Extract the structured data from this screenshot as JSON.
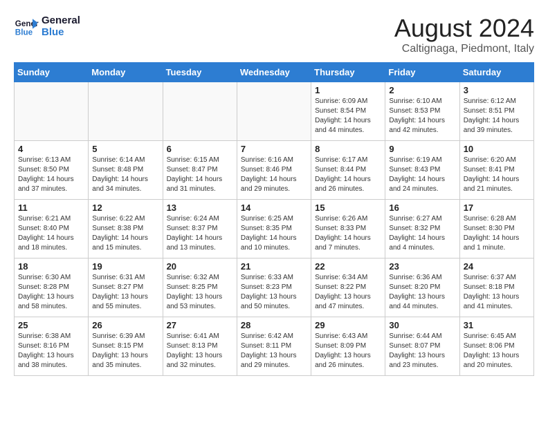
{
  "header": {
    "logo_line1": "General",
    "logo_line2": "Blue",
    "month_year": "August 2024",
    "location": "Caltignaga, Piedmont, Italy"
  },
  "days_of_week": [
    "Sunday",
    "Monday",
    "Tuesday",
    "Wednesday",
    "Thursday",
    "Friday",
    "Saturday"
  ],
  "weeks": [
    [
      {
        "day": "",
        "info": ""
      },
      {
        "day": "",
        "info": ""
      },
      {
        "day": "",
        "info": ""
      },
      {
        "day": "",
        "info": ""
      },
      {
        "day": "1",
        "info": "Sunrise: 6:09 AM\nSunset: 8:54 PM\nDaylight: 14 hours and 44 minutes."
      },
      {
        "day": "2",
        "info": "Sunrise: 6:10 AM\nSunset: 8:53 PM\nDaylight: 14 hours and 42 minutes."
      },
      {
        "day": "3",
        "info": "Sunrise: 6:12 AM\nSunset: 8:51 PM\nDaylight: 14 hours and 39 minutes."
      }
    ],
    [
      {
        "day": "4",
        "info": "Sunrise: 6:13 AM\nSunset: 8:50 PM\nDaylight: 14 hours and 37 minutes."
      },
      {
        "day": "5",
        "info": "Sunrise: 6:14 AM\nSunset: 8:48 PM\nDaylight: 14 hours and 34 minutes."
      },
      {
        "day": "6",
        "info": "Sunrise: 6:15 AM\nSunset: 8:47 PM\nDaylight: 14 hours and 31 minutes."
      },
      {
        "day": "7",
        "info": "Sunrise: 6:16 AM\nSunset: 8:46 PM\nDaylight: 14 hours and 29 minutes."
      },
      {
        "day": "8",
        "info": "Sunrise: 6:17 AM\nSunset: 8:44 PM\nDaylight: 14 hours and 26 minutes."
      },
      {
        "day": "9",
        "info": "Sunrise: 6:19 AM\nSunset: 8:43 PM\nDaylight: 14 hours and 24 minutes."
      },
      {
        "day": "10",
        "info": "Sunrise: 6:20 AM\nSunset: 8:41 PM\nDaylight: 14 hours and 21 minutes."
      }
    ],
    [
      {
        "day": "11",
        "info": "Sunrise: 6:21 AM\nSunset: 8:40 PM\nDaylight: 14 hours and 18 minutes."
      },
      {
        "day": "12",
        "info": "Sunrise: 6:22 AM\nSunset: 8:38 PM\nDaylight: 14 hours and 15 minutes."
      },
      {
        "day": "13",
        "info": "Sunrise: 6:24 AM\nSunset: 8:37 PM\nDaylight: 14 hours and 13 minutes."
      },
      {
        "day": "14",
        "info": "Sunrise: 6:25 AM\nSunset: 8:35 PM\nDaylight: 14 hours and 10 minutes."
      },
      {
        "day": "15",
        "info": "Sunrise: 6:26 AM\nSunset: 8:33 PM\nDaylight: 14 hours and 7 minutes."
      },
      {
        "day": "16",
        "info": "Sunrise: 6:27 AM\nSunset: 8:32 PM\nDaylight: 14 hours and 4 minutes."
      },
      {
        "day": "17",
        "info": "Sunrise: 6:28 AM\nSunset: 8:30 PM\nDaylight: 14 hours and 1 minute."
      }
    ],
    [
      {
        "day": "18",
        "info": "Sunrise: 6:30 AM\nSunset: 8:28 PM\nDaylight: 13 hours and 58 minutes."
      },
      {
        "day": "19",
        "info": "Sunrise: 6:31 AM\nSunset: 8:27 PM\nDaylight: 13 hours and 55 minutes."
      },
      {
        "day": "20",
        "info": "Sunrise: 6:32 AM\nSunset: 8:25 PM\nDaylight: 13 hours and 53 minutes."
      },
      {
        "day": "21",
        "info": "Sunrise: 6:33 AM\nSunset: 8:23 PM\nDaylight: 13 hours and 50 minutes."
      },
      {
        "day": "22",
        "info": "Sunrise: 6:34 AM\nSunset: 8:22 PM\nDaylight: 13 hours and 47 minutes."
      },
      {
        "day": "23",
        "info": "Sunrise: 6:36 AM\nSunset: 8:20 PM\nDaylight: 13 hours and 44 minutes."
      },
      {
        "day": "24",
        "info": "Sunrise: 6:37 AM\nSunset: 8:18 PM\nDaylight: 13 hours and 41 minutes."
      }
    ],
    [
      {
        "day": "25",
        "info": "Sunrise: 6:38 AM\nSunset: 8:16 PM\nDaylight: 13 hours and 38 minutes."
      },
      {
        "day": "26",
        "info": "Sunrise: 6:39 AM\nSunset: 8:15 PM\nDaylight: 13 hours and 35 minutes."
      },
      {
        "day": "27",
        "info": "Sunrise: 6:41 AM\nSunset: 8:13 PM\nDaylight: 13 hours and 32 minutes."
      },
      {
        "day": "28",
        "info": "Sunrise: 6:42 AM\nSunset: 8:11 PM\nDaylight: 13 hours and 29 minutes."
      },
      {
        "day": "29",
        "info": "Sunrise: 6:43 AM\nSunset: 8:09 PM\nDaylight: 13 hours and 26 minutes."
      },
      {
        "day": "30",
        "info": "Sunrise: 6:44 AM\nSunset: 8:07 PM\nDaylight: 13 hours and 23 minutes."
      },
      {
        "day": "31",
        "info": "Sunrise: 6:45 AM\nSunset: 8:06 PM\nDaylight: 13 hours and 20 minutes."
      }
    ]
  ],
  "colors": {
    "header_bg": "#2d7dd2",
    "accent": "#1a6bb5"
  }
}
